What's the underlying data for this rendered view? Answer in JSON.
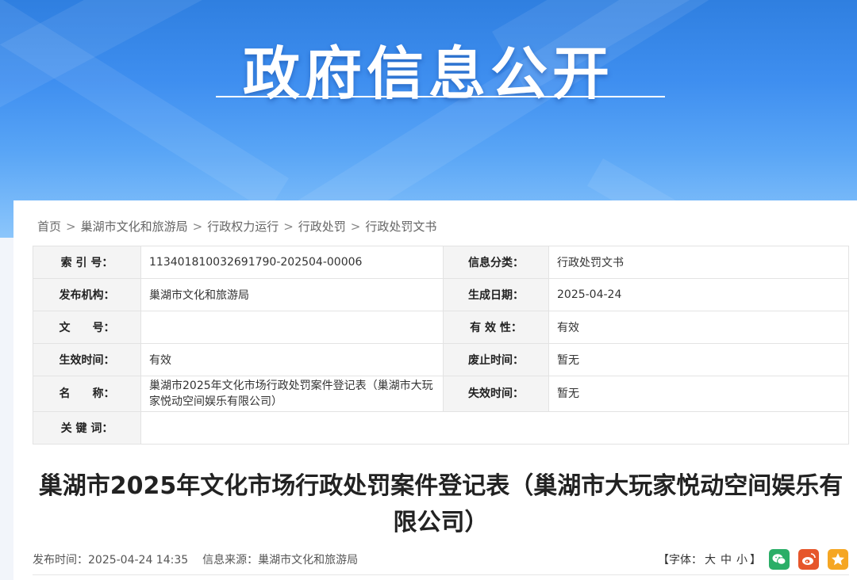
{
  "banner": {
    "title": "政府信息公开"
  },
  "breadcrumb": [
    "首页",
    "巢湖市文化和旅游局",
    "行政权力运行",
    "行政处罚",
    "行政处罚文书"
  ],
  "breadcrumb_sep": ">",
  "meta": {
    "index_label": "索 引 号：",
    "index_value": "113401810032691790-202504-00006",
    "category_label": "信息分类：",
    "category_value": "行政处罚文书",
    "publisher_label": "发布机构：",
    "publisher_value": "巢湖市文化和旅游局",
    "created_label": "生成日期：",
    "created_value": "2025-04-24",
    "docno_label": "文　　号：",
    "docno_value": "",
    "validity_label": "有 效 性：",
    "validity_value": "有效",
    "effective_label": "生效时间：",
    "effective_value": "有效",
    "repeal_label": "废止时间：",
    "repeal_value": "暂无",
    "name_label": "名　　称：",
    "name_value": "巢湖市2025年文化市场行政处罚案件登记表（巢湖市大玩家悦动空间娱乐有限公司）",
    "expire_label": "失效时间：",
    "expire_value": "暂无",
    "keywords_label": "关 键 词：",
    "keywords_value": ""
  },
  "article": {
    "title": "巢湖市2025年文化市场行政处罚案件登记表（巢湖市大玩家悦动空间娱乐有限公司）",
    "publish_time_label": "发布时间：",
    "publish_time": "2025-04-24 14:35",
    "source_label": "信息来源：",
    "source": "巢湖市文化和旅游局"
  },
  "font_size": {
    "open": "【字体：",
    "large": "大",
    "medium": "中",
    "small": "小",
    "close": "】"
  },
  "share_icons": [
    {
      "name": "wechat-icon",
      "color": "#2aae67"
    },
    {
      "name": "weibo-icon",
      "color": "#e6562b"
    },
    {
      "name": "favorite-icon",
      "color": "#f5a623"
    }
  ]
}
